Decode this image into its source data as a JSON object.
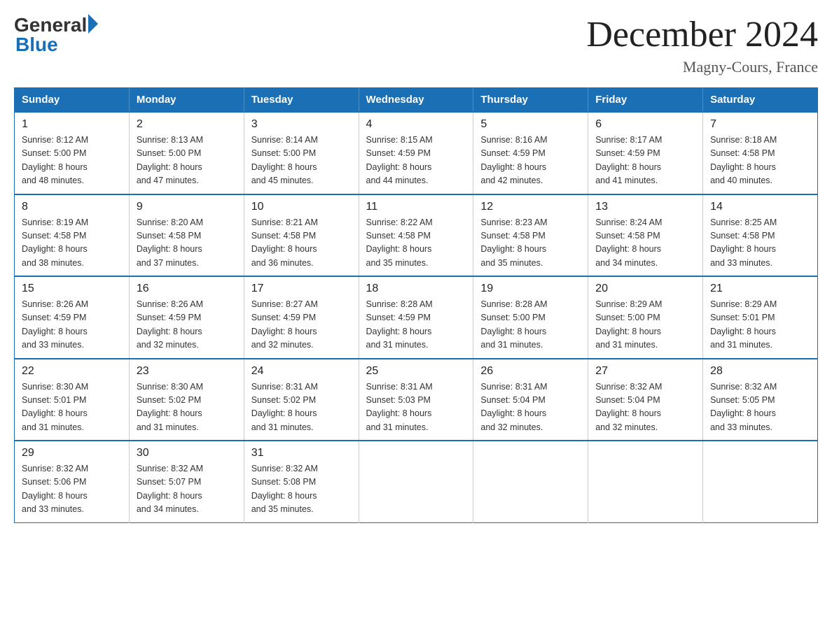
{
  "header": {
    "logo_general": "General",
    "logo_blue": "Blue",
    "title": "December 2024",
    "subtitle": "Magny-Cours, France"
  },
  "days_of_week": [
    "Sunday",
    "Monday",
    "Tuesday",
    "Wednesday",
    "Thursday",
    "Friday",
    "Saturday"
  ],
  "weeks": [
    [
      {
        "day": "1",
        "sunrise": "8:12 AM",
        "sunset": "5:00 PM",
        "daylight": "8 hours and 48 minutes."
      },
      {
        "day": "2",
        "sunrise": "8:13 AM",
        "sunset": "5:00 PM",
        "daylight": "8 hours and 47 minutes."
      },
      {
        "day": "3",
        "sunrise": "8:14 AM",
        "sunset": "5:00 PM",
        "daylight": "8 hours and 45 minutes."
      },
      {
        "day": "4",
        "sunrise": "8:15 AM",
        "sunset": "4:59 PM",
        "daylight": "8 hours and 44 minutes."
      },
      {
        "day": "5",
        "sunrise": "8:16 AM",
        "sunset": "4:59 PM",
        "daylight": "8 hours and 42 minutes."
      },
      {
        "day": "6",
        "sunrise": "8:17 AM",
        "sunset": "4:59 PM",
        "daylight": "8 hours and 41 minutes."
      },
      {
        "day": "7",
        "sunrise": "8:18 AM",
        "sunset": "4:58 PM",
        "daylight": "8 hours and 40 minutes."
      }
    ],
    [
      {
        "day": "8",
        "sunrise": "8:19 AM",
        "sunset": "4:58 PM",
        "daylight": "8 hours and 38 minutes."
      },
      {
        "day": "9",
        "sunrise": "8:20 AM",
        "sunset": "4:58 PM",
        "daylight": "8 hours and 37 minutes."
      },
      {
        "day": "10",
        "sunrise": "8:21 AM",
        "sunset": "4:58 PM",
        "daylight": "8 hours and 36 minutes."
      },
      {
        "day": "11",
        "sunrise": "8:22 AM",
        "sunset": "4:58 PM",
        "daylight": "8 hours and 35 minutes."
      },
      {
        "day": "12",
        "sunrise": "8:23 AM",
        "sunset": "4:58 PM",
        "daylight": "8 hours and 35 minutes."
      },
      {
        "day": "13",
        "sunrise": "8:24 AM",
        "sunset": "4:58 PM",
        "daylight": "8 hours and 34 minutes."
      },
      {
        "day": "14",
        "sunrise": "8:25 AM",
        "sunset": "4:58 PM",
        "daylight": "8 hours and 33 minutes."
      }
    ],
    [
      {
        "day": "15",
        "sunrise": "8:26 AM",
        "sunset": "4:59 PM",
        "daylight": "8 hours and 33 minutes."
      },
      {
        "day": "16",
        "sunrise": "8:26 AM",
        "sunset": "4:59 PM",
        "daylight": "8 hours and 32 minutes."
      },
      {
        "day": "17",
        "sunrise": "8:27 AM",
        "sunset": "4:59 PM",
        "daylight": "8 hours and 32 minutes."
      },
      {
        "day": "18",
        "sunrise": "8:28 AM",
        "sunset": "4:59 PM",
        "daylight": "8 hours and 31 minutes."
      },
      {
        "day": "19",
        "sunrise": "8:28 AM",
        "sunset": "5:00 PM",
        "daylight": "8 hours and 31 minutes."
      },
      {
        "day": "20",
        "sunrise": "8:29 AM",
        "sunset": "5:00 PM",
        "daylight": "8 hours and 31 minutes."
      },
      {
        "day": "21",
        "sunrise": "8:29 AM",
        "sunset": "5:01 PM",
        "daylight": "8 hours and 31 minutes."
      }
    ],
    [
      {
        "day": "22",
        "sunrise": "8:30 AM",
        "sunset": "5:01 PM",
        "daylight": "8 hours and 31 minutes."
      },
      {
        "day": "23",
        "sunrise": "8:30 AM",
        "sunset": "5:02 PM",
        "daylight": "8 hours and 31 minutes."
      },
      {
        "day": "24",
        "sunrise": "8:31 AM",
        "sunset": "5:02 PM",
        "daylight": "8 hours and 31 minutes."
      },
      {
        "day": "25",
        "sunrise": "8:31 AM",
        "sunset": "5:03 PM",
        "daylight": "8 hours and 31 minutes."
      },
      {
        "day": "26",
        "sunrise": "8:31 AM",
        "sunset": "5:04 PM",
        "daylight": "8 hours and 32 minutes."
      },
      {
        "day": "27",
        "sunrise": "8:32 AM",
        "sunset": "5:04 PM",
        "daylight": "8 hours and 32 minutes."
      },
      {
        "day": "28",
        "sunrise": "8:32 AM",
        "sunset": "5:05 PM",
        "daylight": "8 hours and 33 minutes."
      }
    ],
    [
      {
        "day": "29",
        "sunrise": "8:32 AM",
        "sunset": "5:06 PM",
        "daylight": "8 hours and 33 minutes."
      },
      {
        "day": "30",
        "sunrise": "8:32 AM",
        "sunset": "5:07 PM",
        "daylight": "8 hours and 34 minutes."
      },
      {
        "day": "31",
        "sunrise": "8:32 AM",
        "sunset": "5:08 PM",
        "daylight": "8 hours and 35 minutes."
      },
      null,
      null,
      null,
      null
    ]
  ],
  "labels": {
    "sunrise": "Sunrise:",
    "sunset": "Sunset:",
    "daylight": "Daylight:"
  }
}
